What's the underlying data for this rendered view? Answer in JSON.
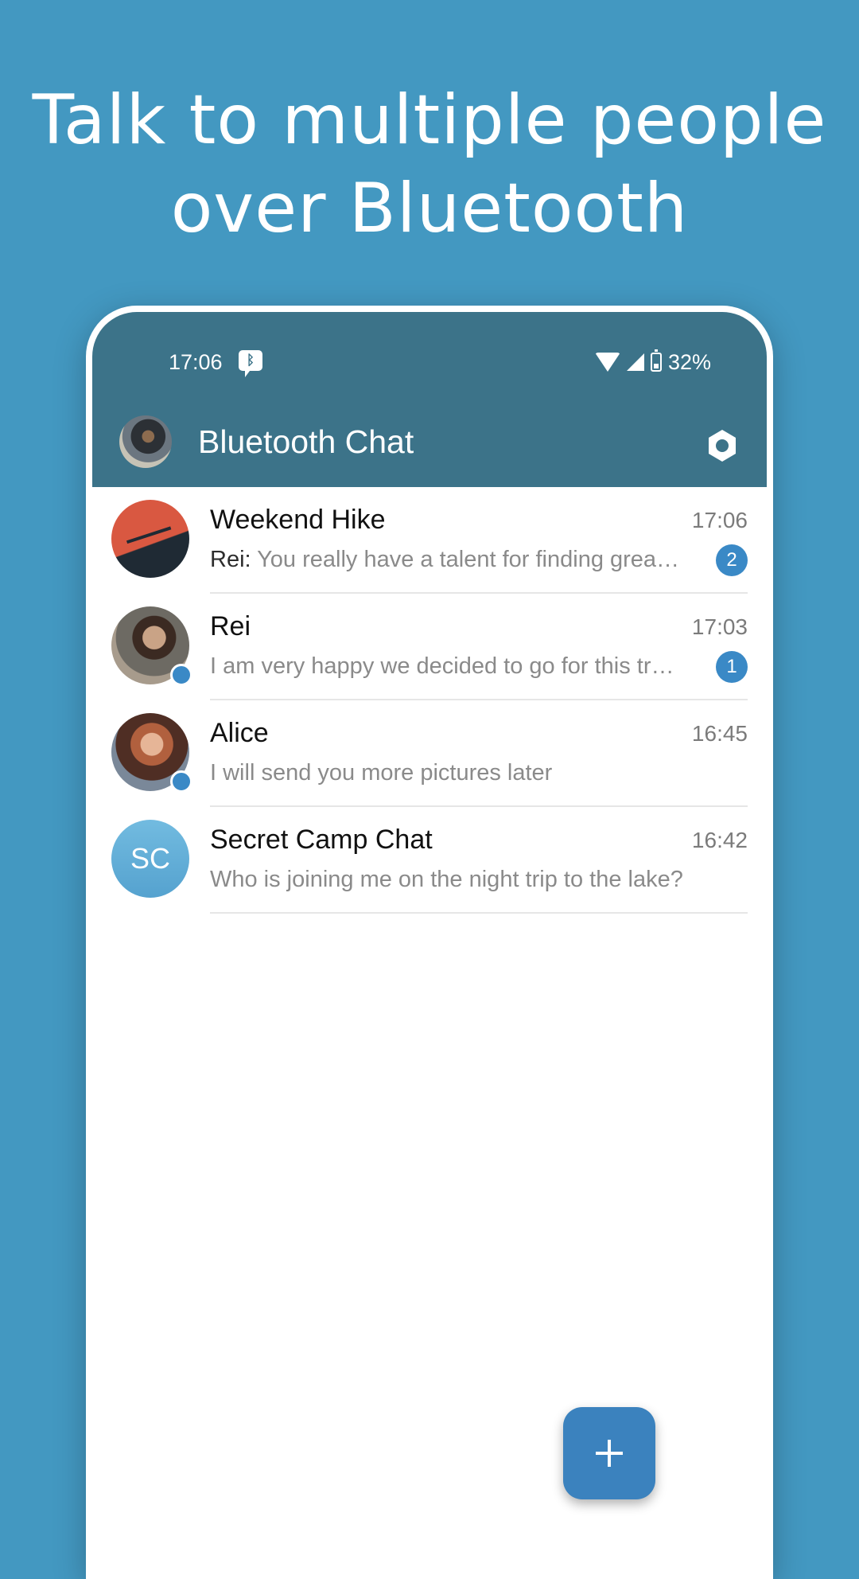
{
  "headline": {
    "line1": "Talk to multiple people",
    "line2": "over Bluetooth"
  },
  "status_bar": {
    "time": "17:06",
    "battery": "32%",
    "icons": [
      "bluetooth-message-icon",
      "wifi-icon",
      "signal-icon",
      "battery-icon"
    ]
  },
  "app_bar": {
    "title": "Bluetooth Chat",
    "settings_icon": "settings-icon"
  },
  "chats": [
    {
      "name": "Weekend Hike",
      "time": "17:06",
      "sender": "Rei:",
      "preview": "You really have a talent for finding grea…",
      "unread": "2"
    },
    {
      "name": "Rei",
      "time": "17:03",
      "preview": "I am very happy we decided to go for this tr…",
      "unread": "1"
    },
    {
      "name": "Alice",
      "time": "16:45",
      "preview": "I will send you more pictures later"
    },
    {
      "name": "Secret Camp Chat",
      "initials": "SC",
      "time": "16:42",
      "preview": "Who is joining me on the night trip to the lake?"
    }
  ],
  "fab": {
    "icon": "plus-icon"
  },
  "colors": {
    "background": "#4398c1",
    "app_bar": "#3c7389",
    "accent": "#3a89c6"
  }
}
